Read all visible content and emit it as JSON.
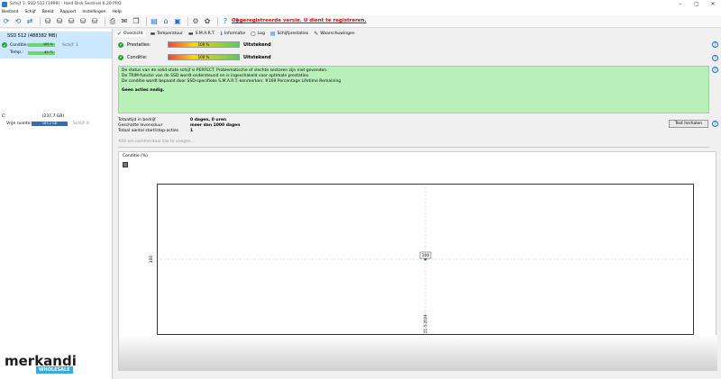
{
  "window": {
    "title": "Schijf 1: SSD 512 [1969] - Hard Disk Sentinel 6.20 PRO"
  },
  "menu": [
    "Bestand",
    "Schijf",
    "Beeld",
    "Rapport",
    "Instellingen",
    "Help"
  ],
  "unregistered_text": "Ongeregistreerde versie. U dient te registreren.",
  "sidebar": {
    "disk_name": "SSD 512 (488382 MB)",
    "rows": [
      {
        "label": "Conditie:",
        "value": "100 %",
        "extra": "Schijf: 1"
      },
      {
        "label": "Temp.:",
        "value": "40 °C",
        "extra": ""
      }
    ],
    "volume": {
      "letter": "C:",
      "size": "(237,7 GB)",
      "free_label": "Vrije ruimte:",
      "free_value": "163,2 GB",
      "disk_ref": "Schijf: 0"
    }
  },
  "watermark": {
    "brand": "merkandi",
    "badge": "WHOLESALE"
  },
  "tabs": [
    {
      "label": "Overzicht",
      "icon": "✔"
    },
    {
      "label": "Temperatuur",
      "icon": "▬"
    },
    {
      "label": "S.M.A.R.T.",
      "icon": "▬"
    },
    {
      "label": "Informatie",
      "icon": "ℹ"
    },
    {
      "label": "Log",
      "icon": "▢"
    },
    {
      "label": "Schijfprestaties",
      "icon": "▤"
    },
    {
      "label": "Waarschuwingen",
      "icon": "✎"
    }
  ],
  "status": {
    "performance": {
      "label": "Prestaties:",
      "value": "100 %",
      "verdict": "Uitstekend",
      "percent": 100
    },
    "health": {
      "label": "Conditie:",
      "value": "100 %",
      "verdict": "Uitstekend",
      "percent": 100
    }
  },
  "message": {
    "lines": [
      "De status van de solid-state schijf is PERFECT. Problematische of slechte sectoren zijn niet gevonden.",
      "De TRIM-functie van de SSD wordt ondersteund en is ingeschakeld voor optimale prestaties.",
      "De conditie wordt bepaald door SSD-specifieke S.M.A.R.T.-kenmerken: #169 Percentage Lifetime Remaining"
    ],
    "bold": "Geen acties nodig."
  },
  "info": {
    "rows": [
      {
        "key": "Totaaltijd in bedrijf",
        "value": "0 dagen, 0 uren"
      },
      {
        "key": "Geschatte levensduur",
        "value": "meer dan 1000 dagen"
      },
      {
        "key": "Totaal aantal start/stop-acties",
        "value": "1"
      }
    ],
    "test_button": "Test herhalen",
    "comment_placeholder": "Klik om commentaar toe te voegen..."
  },
  "chart_data": {
    "type": "line",
    "title": "Conditie (%)",
    "x": [
      "21-3-2024"
    ],
    "series": [
      {
        "values": [
          100
        ]
      }
    ],
    "ylabel_tick": "100",
    "point_label": "100",
    "ylim": [
      100,
      100
    ],
    "grid": true
  }
}
